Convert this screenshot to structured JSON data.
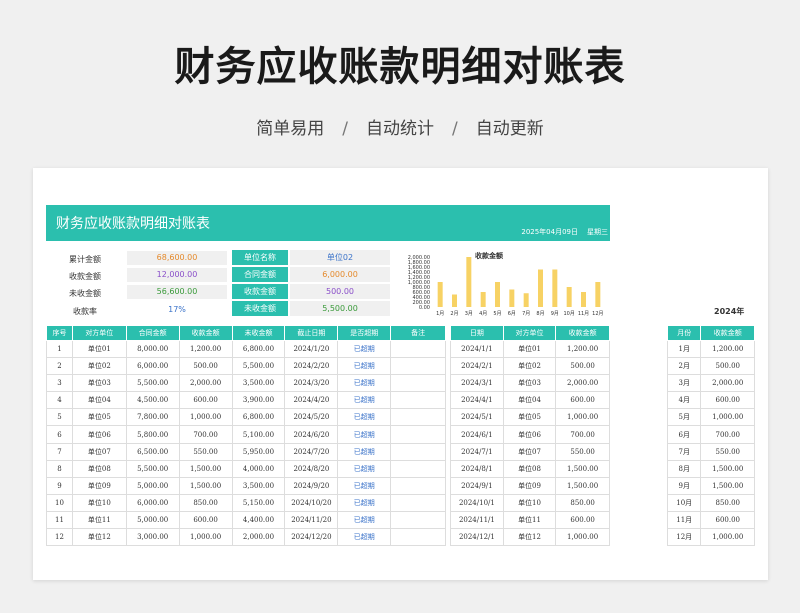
{
  "hero": {
    "title": "财务应收账款明细对账表",
    "tags": [
      "简单易用",
      "自动统计",
      "自动更新"
    ],
    "separator": "/"
  },
  "sheet": {
    "title": "财务应收账款明细对账表",
    "date": "2025年04月09日",
    "weekday": "星期三",
    "summary": {
      "total_label": "累计金额",
      "total_value": "68,600.00",
      "received_label": "收款金额",
      "received_value": "12,000.00",
      "unreceived_label": "未收金额",
      "unreceived_value": "56,600.00",
      "rate_label": "收款率",
      "rate_value": "17%",
      "unit_label": "单位名称",
      "unit_value": "单位02",
      "contract_label": "合同金额",
      "contract_value": "6,000.00",
      "paid_label": "收款金额",
      "paid_value": "500.00",
      "unpaid_label": "未收金额",
      "unpaid_value": "5,500.00"
    },
    "colors": {
      "accent": "#2bbfae",
      "orange": "#e58a2c",
      "purple": "#8a4fc9",
      "green": "#3a9a3a",
      "blue": "#3b73c9",
      "bar": "#f7d264"
    },
    "year_label": "2024年",
    "main_headers": [
      "序号",
      "对方单位",
      "合同金额",
      "收款金额",
      "未收金额",
      "截止日期",
      "是否超期",
      "备注"
    ],
    "main_rows": [
      [
        "1",
        "单位01",
        "8,000.00",
        "1,200.00",
        "6,800.00",
        "2024/1/20",
        "已超期",
        ""
      ],
      [
        "2",
        "单位02",
        "6,000.00",
        "500.00",
        "5,500.00",
        "2024/2/20",
        "已超期",
        ""
      ],
      [
        "3",
        "单位03",
        "5,500.00",
        "2,000.00",
        "3,500.00",
        "2024/3/20",
        "已超期",
        ""
      ],
      [
        "4",
        "单位04",
        "4,500.00",
        "600.00",
        "3,900.00",
        "2024/4/20",
        "已超期",
        ""
      ],
      [
        "5",
        "单位05",
        "7,800.00",
        "1,000.00",
        "6,800.00",
        "2024/5/20",
        "已超期",
        ""
      ],
      [
        "6",
        "单位06",
        "5,800.00",
        "700.00",
        "5,100.00",
        "2024/6/20",
        "已超期",
        ""
      ],
      [
        "7",
        "单位07",
        "6,500.00",
        "550.00",
        "5,950.00",
        "2024/7/20",
        "已超期",
        ""
      ],
      [
        "8",
        "单位08",
        "5,500.00",
        "1,500.00",
        "4,000.00",
        "2024/8/20",
        "已超期",
        ""
      ],
      [
        "9",
        "单位09",
        "5,000.00",
        "1,500.00",
        "3,500.00",
        "2024/9/20",
        "已超期",
        ""
      ],
      [
        "10",
        "单位10",
        "6,000.00",
        "850.00",
        "5,150.00",
        "2024/10/20",
        "已超期",
        ""
      ],
      [
        "11",
        "单位11",
        "5,000.00",
        "600.00",
        "4,400.00",
        "2024/11/20",
        "已超期",
        ""
      ],
      [
        "12",
        "单位12",
        "3,000.00",
        "1,000.00",
        "2,000.00",
        "2024/12/20",
        "已超期",
        ""
      ]
    ],
    "receipt_headers": [
      "日期",
      "对方单位",
      "收款金额"
    ],
    "receipt_rows": [
      [
        "2024/1/1",
        "单位01",
        "1,200.00"
      ],
      [
        "2024/2/1",
        "单位02",
        "500.00"
      ],
      [
        "2024/3/1",
        "单位03",
        "2,000.00"
      ],
      [
        "2024/4/1",
        "单位04",
        "600.00"
      ],
      [
        "2024/5/1",
        "单位05",
        "1,000.00"
      ],
      [
        "2024/6/1",
        "单位06",
        "700.00"
      ],
      [
        "2024/7/1",
        "单位07",
        "550.00"
      ],
      [
        "2024/8/1",
        "单位08",
        "1,500.00"
      ],
      [
        "2024/9/1",
        "单位09",
        "1,500.00"
      ],
      [
        "2024/10/1",
        "单位10",
        "850.00"
      ],
      [
        "2024/11/1",
        "单位11",
        "600.00"
      ],
      [
        "2024/12/1",
        "单位12",
        "1,000.00"
      ]
    ],
    "month_headers": [
      "月份",
      "收款金额"
    ],
    "month_rows": [
      [
        "1月",
        "1,200.00"
      ],
      [
        "2月",
        "500.00"
      ],
      [
        "3月",
        "2,000.00"
      ],
      [
        "4月",
        "600.00"
      ],
      [
        "5月",
        "1,000.00"
      ],
      [
        "6月",
        "700.00"
      ],
      [
        "7月",
        "550.00"
      ],
      [
        "8月",
        "1,500.00"
      ],
      [
        "9月",
        "1,500.00"
      ],
      [
        "10月",
        "850.00"
      ],
      [
        "11月",
        "600.00"
      ],
      [
        "12月",
        "1,000.00"
      ]
    ]
  },
  "chart_data": {
    "type": "bar",
    "title": "收款金额",
    "categories": [
      "1月",
      "2月",
      "3月",
      "4月",
      "5月",
      "6月",
      "7月",
      "8月",
      "9月",
      "10月",
      "11月",
      "12月"
    ],
    "values": [
      1000,
      500,
      2000,
      600,
      1000,
      700,
      550,
      1500,
      1500,
      800,
      600,
      1000
    ],
    "yticks": [
      "2,000.00",
      "1,800.00",
      "1,600.00",
      "1,400.00",
      "1,200.00",
      "1,000.00",
      "800.00",
      "600.00",
      "400.00",
      "200.00",
      "0.00"
    ],
    "ylim": [
      0,
      2000
    ],
    "legend": "none",
    "grid": false
  }
}
